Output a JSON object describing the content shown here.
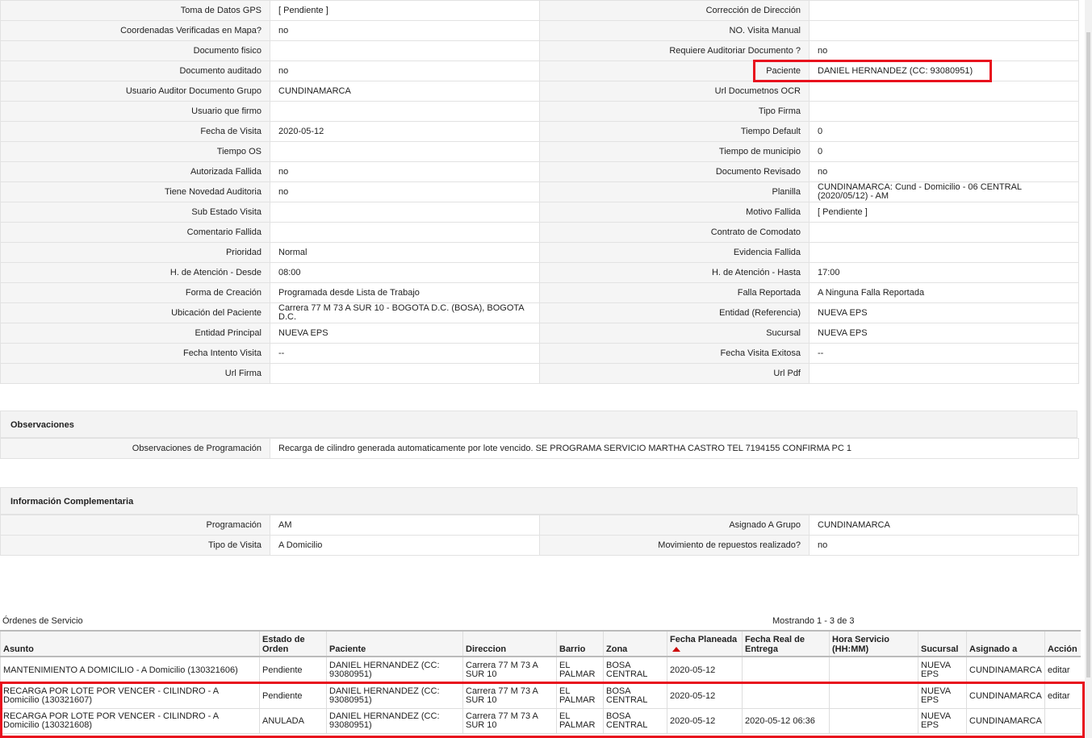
{
  "details": [
    {
      "l1": "Toma de Datos GPS",
      "v1": "[ Pendiente ]",
      "l2": "Corrección de Dirección",
      "v2": ""
    },
    {
      "l1": "Coordenadas Verificadas en Mapa?",
      "v1": " no",
      "l2": "NO. Visita Manual",
      "v2": ""
    },
    {
      "l1": "Documento fisico",
      "v1": "",
      "l2": "Requiere Auditoriar Documento ?",
      "v2": " no"
    },
    {
      "l1": "Documento auditado",
      "v1": " no",
      "l2": "Paciente",
      "v2": "DANIEL HERNANDEZ (CC: 93080951)"
    },
    {
      "l1": "Usuario Auditor Documento Grupo",
      "v1": "CUNDINAMARCA",
      "l2": "Url Documetnos OCR",
      "v2": ""
    },
    {
      "l1": "Usuario que firmo",
      "v1": "",
      "l2": "Tipo Firma",
      "v2": ""
    },
    {
      "l1": "Fecha de Visita",
      "v1": " 2020-05-12",
      "l2": "Tiempo Default",
      "v2": "0"
    },
    {
      "l1": "Tiempo OS",
      "v1": "",
      "l2": "Tiempo de municipio",
      "v2": "0"
    },
    {
      "l1": "Autorizada Fallida",
      "v1": " no",
      "l2": "Documento Revisado",
      "v2": " no"
    },
    {
      "l1": "Tiene Novedad Auditoria",
      "v1": " no",
      "l2": "Planilla",
      "v2": "CUNDINAMARCA: Cund - Domicilio - 06 CENTRAL (2020/05/12) - AM"
    },
    {
      "l1": "Sub Estado Visita",
      "v1": "",
      "l2": "Motivo Fallida",
      "v2": "[ Pendiente ]"
    },
    {
      "l1": "Comentario Fallida",
      "v1": "",
      "l2": "Contrato de Comodato",
      "v2": ""
    },
    {
      "l1": "Prioridad",
      "v1": "Normal",
      "l2": "Evidencia Fallida",
      "v2": ""
    },
    {
      "l1": "H. de Atención - Desde",
      "v1": "08:00",
      "l2": "H. de Atención - Hasta",
      "v2": "17:00"
    },
    {
      "l1": "Forma de Creación",
      "v1": "Programada desde Lista de Trabajo",
      "l2": "Falla Reportada",
      "v2": "A Ninguna Falla Reportada"
    },
    {
      "l1": "Ubicación del Paciente",
      "v1": "Carrera 77 M 73 A SUR 10 - BOGOTA D.C. (BOSA), BOGOTA D.C.",
      "l2": "Entidad (Referencia)",
      "v2": "NUEVA EPS"
    },
    {
      "l1": "Entidad Principal",
      "v1": "NUEVA EPS",
      "l2": "Sucursal",
      "v2": "NUEVA EPS"
    },
    {
      "l1": "Fecha Intento Visita",
      "v1": " --",
      "l2": "Fecha Visita Exitosa",
      "v2": " --"
    },
    {
      "l1": "Url Firma",
      "v1": "",
      "l2": "Url Pdf",
      "v2": ""
    }
  ],
  "observaciones": {
    "title": "Observaciones",
    "label": "Observaciones de Programación",
    "value": " Recarga de cilindro generada automaticamente por lote vencido. SE PROGRAMA SERVICIO MARTHA CASTRO TEL 7194155 CONFIRMA PC 1"
  },
  "info": {
    "title": "Información Complementaria",
    "rows": [
      {
        "l1": "Programación",
        "v1": "AM",
        "l2": "Asignado A Grupo",
        "v2": "CUNDINAMARCA"
      },
      {
        "l1": "Tipo de Visita",
        "v1": "A Domicilio",
        "l2": "Movimiento de repuestos realizado?",
        "v2": " no"
      }
    ]
  },
  "orders": {
    "title": "Órdenes de Servicio",
    "showing": "Mostrando 1 - 3 de 3",
    "headers": [
      "Asunto",
      "Estado de Orden",
      "Paciente",
      "Direccion",
      "Barrio",
      "Zona",
      "Fecha Planeada",
      "Fecha Real de Entrega",
      "Hora Servicio (HH:MM)",
      "Sucursal",
      "Asignado a",
      "Acción"
    ],
    "rows": [
      [
        "MANTENIMIENTO A DOMICILIO - A Domicilio (130321606)",
        "Pendiente",
        "DANIEL HERNANDEZ (CC: 93080951)",
        "Carrera 77 M 73 A SUR 10",
        "EL PALMAR",
        "BOSA CENTRAL",
        "2020-05-12",
        "",
        "",
        "NUEVA EPS",
        "CUNDINAMARCA",
        "editar"
      ],
      [
        "RECARGA POR LOTE POR VENCER - CILINDRO - A Domicilio (130321607)",
        "Pendiente",
        "DANIEL HERNANDEZ (CC: 93080951)",
        "Carrera 77 M 73 A SUR 10",
        "EL PALMAR",
        "BOSA CENTRAL",
        "2020-05-12",
        "",
        "",
        "NUEVA EPS",
        "CUNDINAMARCA",
        "editar"
      ],
      [
        "RECARGA POR LOTE POR VENCER - CILINDRO - A Domicilio (130321608)",
        "ANULADA",
        "DANIEL HERNANDEZ (CC: 93080951)",
        "Carrera 77 M 73 A SUR 10",
        "EL PALMAR",
        "BOSA CENTRAL",
        "2020-05-12",
        "2020-05-12 06:36",
        "",
        "NUEVA EPS",
        "CUNDINAMARCA",
        ""
      ]
    ]
  },
  "colors": {
    "highlight": "#e8101d",
    "sort_arrow": "#cc0000"
  }
}
